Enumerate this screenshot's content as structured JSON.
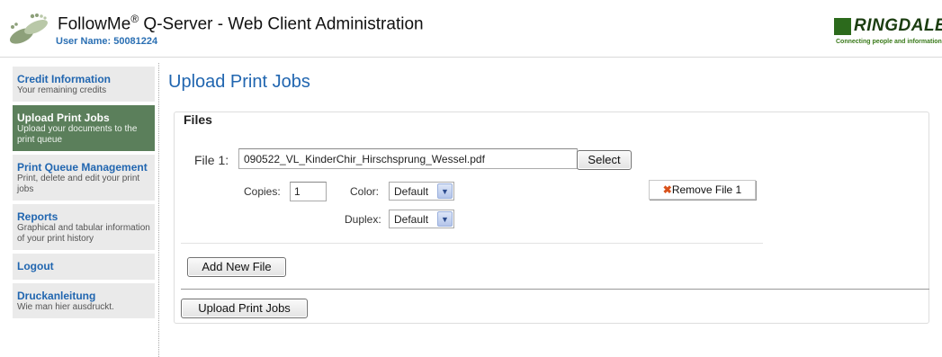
{
  "header": {
    "app_name": "FollowMe",
    "registered_mark": "®",
    "app_title_rest": " Q-Server - Web Client Administration",
    "username_label": "User Name: ",
    "username_value": "50081224",
    "brand_name": "RINGDALE",
    "brand_tagline": "Connecting people and information"
  },
  "sidebar": {
    "items": [
      {
        "title": "Credit Information",
        "desc": "Your remaining credits"
      },
      {
        "title": "Upload Print Jobs",
        "desc": "Upload your documents to the print queue"
      },
      {
        "title": "Print Queue Management",
        "desc": "Print, delete and edit your print jobs"
      },
      {
        "title": "Reports",
        "desc": "Graphical and tabular information of your print history"
      },
      {
        "title": "Logout",
        "desc": ""
      },
      {
        "title": "Druckanleitung",
        "desc": "Wie man hier ausdruckt."
      }
    ],
    "active_index": 1
  },
  "main": {
    "page_title": "Upload Print Jobs",
    "files_legend": "Files",
    "file1": {
      "label": "File 1:",
      "value": "090522_VL_KinderChir_Hirschsprung_Wessel.pdf",
      "select_label": "Select",
      "copies_label": "Copies:",
      "copies_value": "1",
      "color_label": "Color:",
      "color_value": "Default",
      "duplex_label": "Duplex:",
      "duplex_value": "Default",
      "remove_label": "Remove File 1"
    },
    "add_new_file_label": "Add New File",
    "upload_label": "Upload Print Jobs"
  },
  "colors": {
    "accent_blue": "#2166b0",
    "active_nav": "#5b7f5b",
    "brand_green": "#2c6a1c",
    "remove_icon": "#d9521b"
  },
  "icons": {
    "logo": "footprints-icon",
    "brand_mark": "ringdale-logo-icon",
    "remove": "close-x-icon",
    "dropdown": "chevron-down-icon"
  }
}
